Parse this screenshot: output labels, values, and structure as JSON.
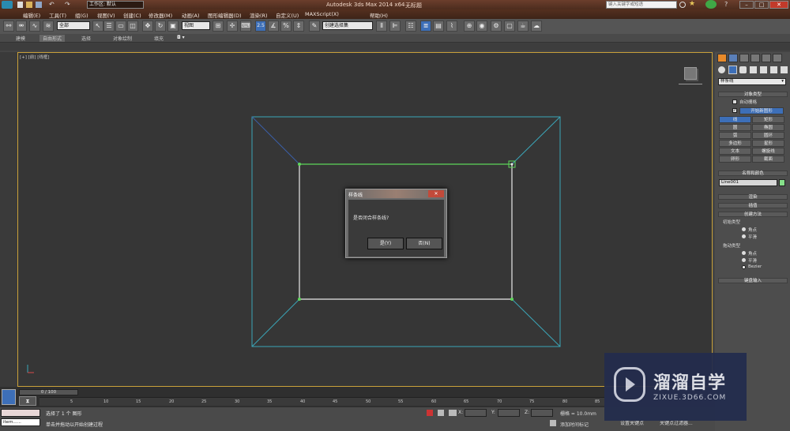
{
  "title": {
    "workspace_label": "工作区: 默认",
    "app_title": "Autodesk 3ds Max  2014 x64",
    "doc_title": "无标题",
    "search_placeholder": "键入关键字或短语"
  },
  "menu": [
    "编辑(E)",
    "工具(T)",
    "组(G)",
    "视图(V)",
    "创建(C)",
    "修改器(M)",
    "动画(A)",
    "图形编辑器(D)",
    "渲染(R)",
    "自定义(U)",
    "MAXScript(X)",
    "帮助(H)"
  ],
  "toolbar": {
    "selection_filter": "全部",
    "ref_coord": "视图",
    "snap_label": "2.5",
    "named_selection": "创建选择集"
  },
  "ribbon_tabs": [
    "建模",
    "自由形式",
    "选择",
    "对象绘制",
    "填充"
  ],
  "viewport": {
    "label": "[+] [前] [线框]"
  },
  "command_panel": {
    "category": "样条线",
    "object_type_header": "对象类型",
    "auto_grid": "自动栅格",
    "start_new_shape": "开始新图形",
    "object_buttons": [
      "线",
      "矩形",
      "圆",
      "椭圆",
      "弧",
      "圆环",
      "多边形",
      "星形",
      "文本",
      "螺旋线",
      "卵形",
      "截面"
    ],
    "name_color_header": "名称和颜色",
    "object_name": "Line001",
    "object_color": "#86e08a",
    "render_header": "渲染",
    "interp_header": "插值",
    "creation_header": "创建方法",
    "initial_type_label": "初始类型",
    "initial_options": [
      "角点",
      "平滑"
    ],
    "drag_type_label": "拖动类型",
    "drag_options": [
      "角点",
      "平滑",
      "Bezier"
    ],
    "keyboard_header": "键盘输入"
  },
  "dialog": {
    "title": "样条线",
    "message": "是否闭合样条线?",
    "yes_label": "是(Y)",
    "no_label": "否(N)"
  },
  "timeline": {
    "frame_display": "0 / 100",
    "ticks": [
      "5",
      "10",
      "15",
      "20",
      "25",
      "30",
      "35",
      "40",
      "45",
      "50",
      "55",
      "60",
      "65",
      "70",
      "75",
      "80",
      "85"
    ]
  },
  "status": {
    "selection_info": "选择了 1 个 图形",
    "prompt": "单击并拖动以开始创建过程",
    "script_field": "item......",
    "x_label": "X:",
    "y_label": "Y:",
    "z_label": "Z:",
    "grid_label": "栅格 = 10.0mm",
    "add_time_tag": "添加时间标记",
    "set_key": "设置关键点",
    "key_filters": "关键点过滤器..."
  },
  "watermark": {
    "brand": "溜溜自学",
    "url": "ZIXUE.3D66.COM"
  }
}
